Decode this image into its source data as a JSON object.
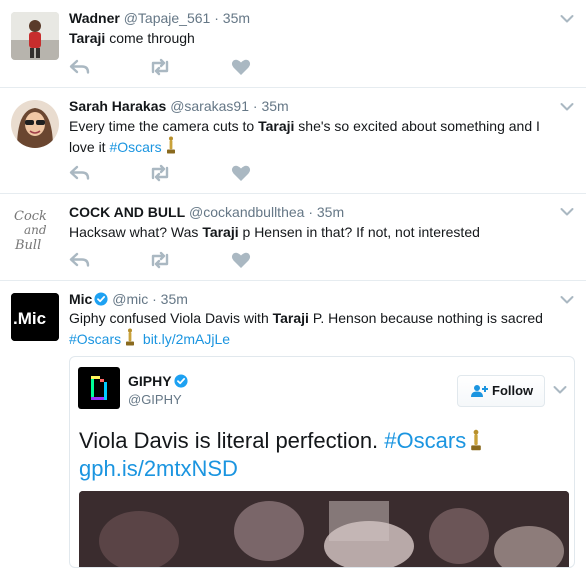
{
  "tweets": [
    {
      "name": "Wadner",
      "handle": "@Tapaje_561",
      "dot": "·",
      "time": "35m",
      "text_bold": "Taraji",
      "text_rest": " come through"
    },
    {
      "name": "Sarah Harakas",
      "handle": "@sarakas91",
      "dot": "·",
      "time": "35m",
      "text_before": "Every time the camera cuts to ",
      "text_bold": "Taraji",
      "text_after": " she's so excited about something and I love it",
      "hashtag": "#Oscars"
    },
    {
      "name": "COCK AND BULL",
      "handle": "@cockandbullthea",
      "dot": "·",
      "time": "35m",
      "avatar_script": [
        "Cock",
        "and",
        "Bull"
      ],
      "text_before": "Hacksaw what? Was ",
      "text_bold": "Taraji",
      "text_after": " p Hensen in that? If not, not interested"
    },
    {
      "name": "Mic",
      "handle": "@mic",
      "dot": "·",
      "time": "35m",
      "avatar_label": ".Mic",
      "text_before": "Giphy confused Viola Davis with ",
      "text_bold": "Taraji",
      "text_after": " P. Henson because nothing is sacred",
      "hashtag": "#Oscars",
      "link": "bit.ly/2mAJjLe"
    }
  ],
  "card": {
    "name": "GIPHY",
    "handle": "@GIPHY",
    "follow_label": "Follow",
    "text": "Viola Davis is literal perfection.",
    "hashtag": "#Oscars",
    "link": "gph.is/2mtxNSD"
  },
  "colors": {
    "accent": "#1b95e0",
    "muted": "#657786",
    "icon": "#aab8c2",
    "border": "#e6ecf0"
  },
  "icons": [
    "reply-icon",
    "retweet-icon",
    "like-icon",
    "caret-down-icon",
    "verified-icon",
    "oscar-statuette-icon",
    "follow-user-plus-icon"
  ]
}
